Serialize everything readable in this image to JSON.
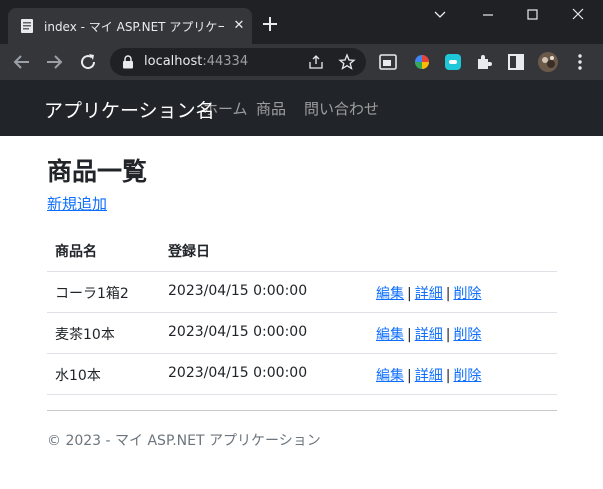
{
  "browser": {
    "tab": {
      "title": "index - マイ ASP.NET アプリケーション",
      "close": "✕"
    },
    "new_tab": "+",
    "address": {
      "host": "localhost",
      "port": ":44334"
    }
  },
  "site": {
    "brand": "アプリケーション名",
    "nav": [
      "ホーム",
      "商品",
      "問い合わせ"
    ]
  },
  "main": {
    "heading": "商品一覧",
    "create_link": "新規追加",
    "table": {
      "headers": [
        "商品名",
        "登録日"
      ],
      "rows": [
        {
          "name": "コーラ1箱2",
          "date": "2023/04/15 0:00:00"
        },
        {
          "name": "麦茶10本",
          "date": "2023/04/15 0:00:00"
        },
        {
          "name": "水10本",
          "date": "2023/04/15 0:00:00"
        }
      ],
      "actions": {
        "edit": "編集",
        "details": "詳細",
        "delete": "削除",
        "separator": "|"
      }
    }
  },
  "footer": {
    "text": "© 2023 - マイ ASP.NET アプリケーション"
  },
  "colors": {
    "chrome_bg": "#202124",
    "toolbar_bg": "#35363a",
    "navbar_bg": "#212529",
    "link": "#0d6efd"
  }
}
